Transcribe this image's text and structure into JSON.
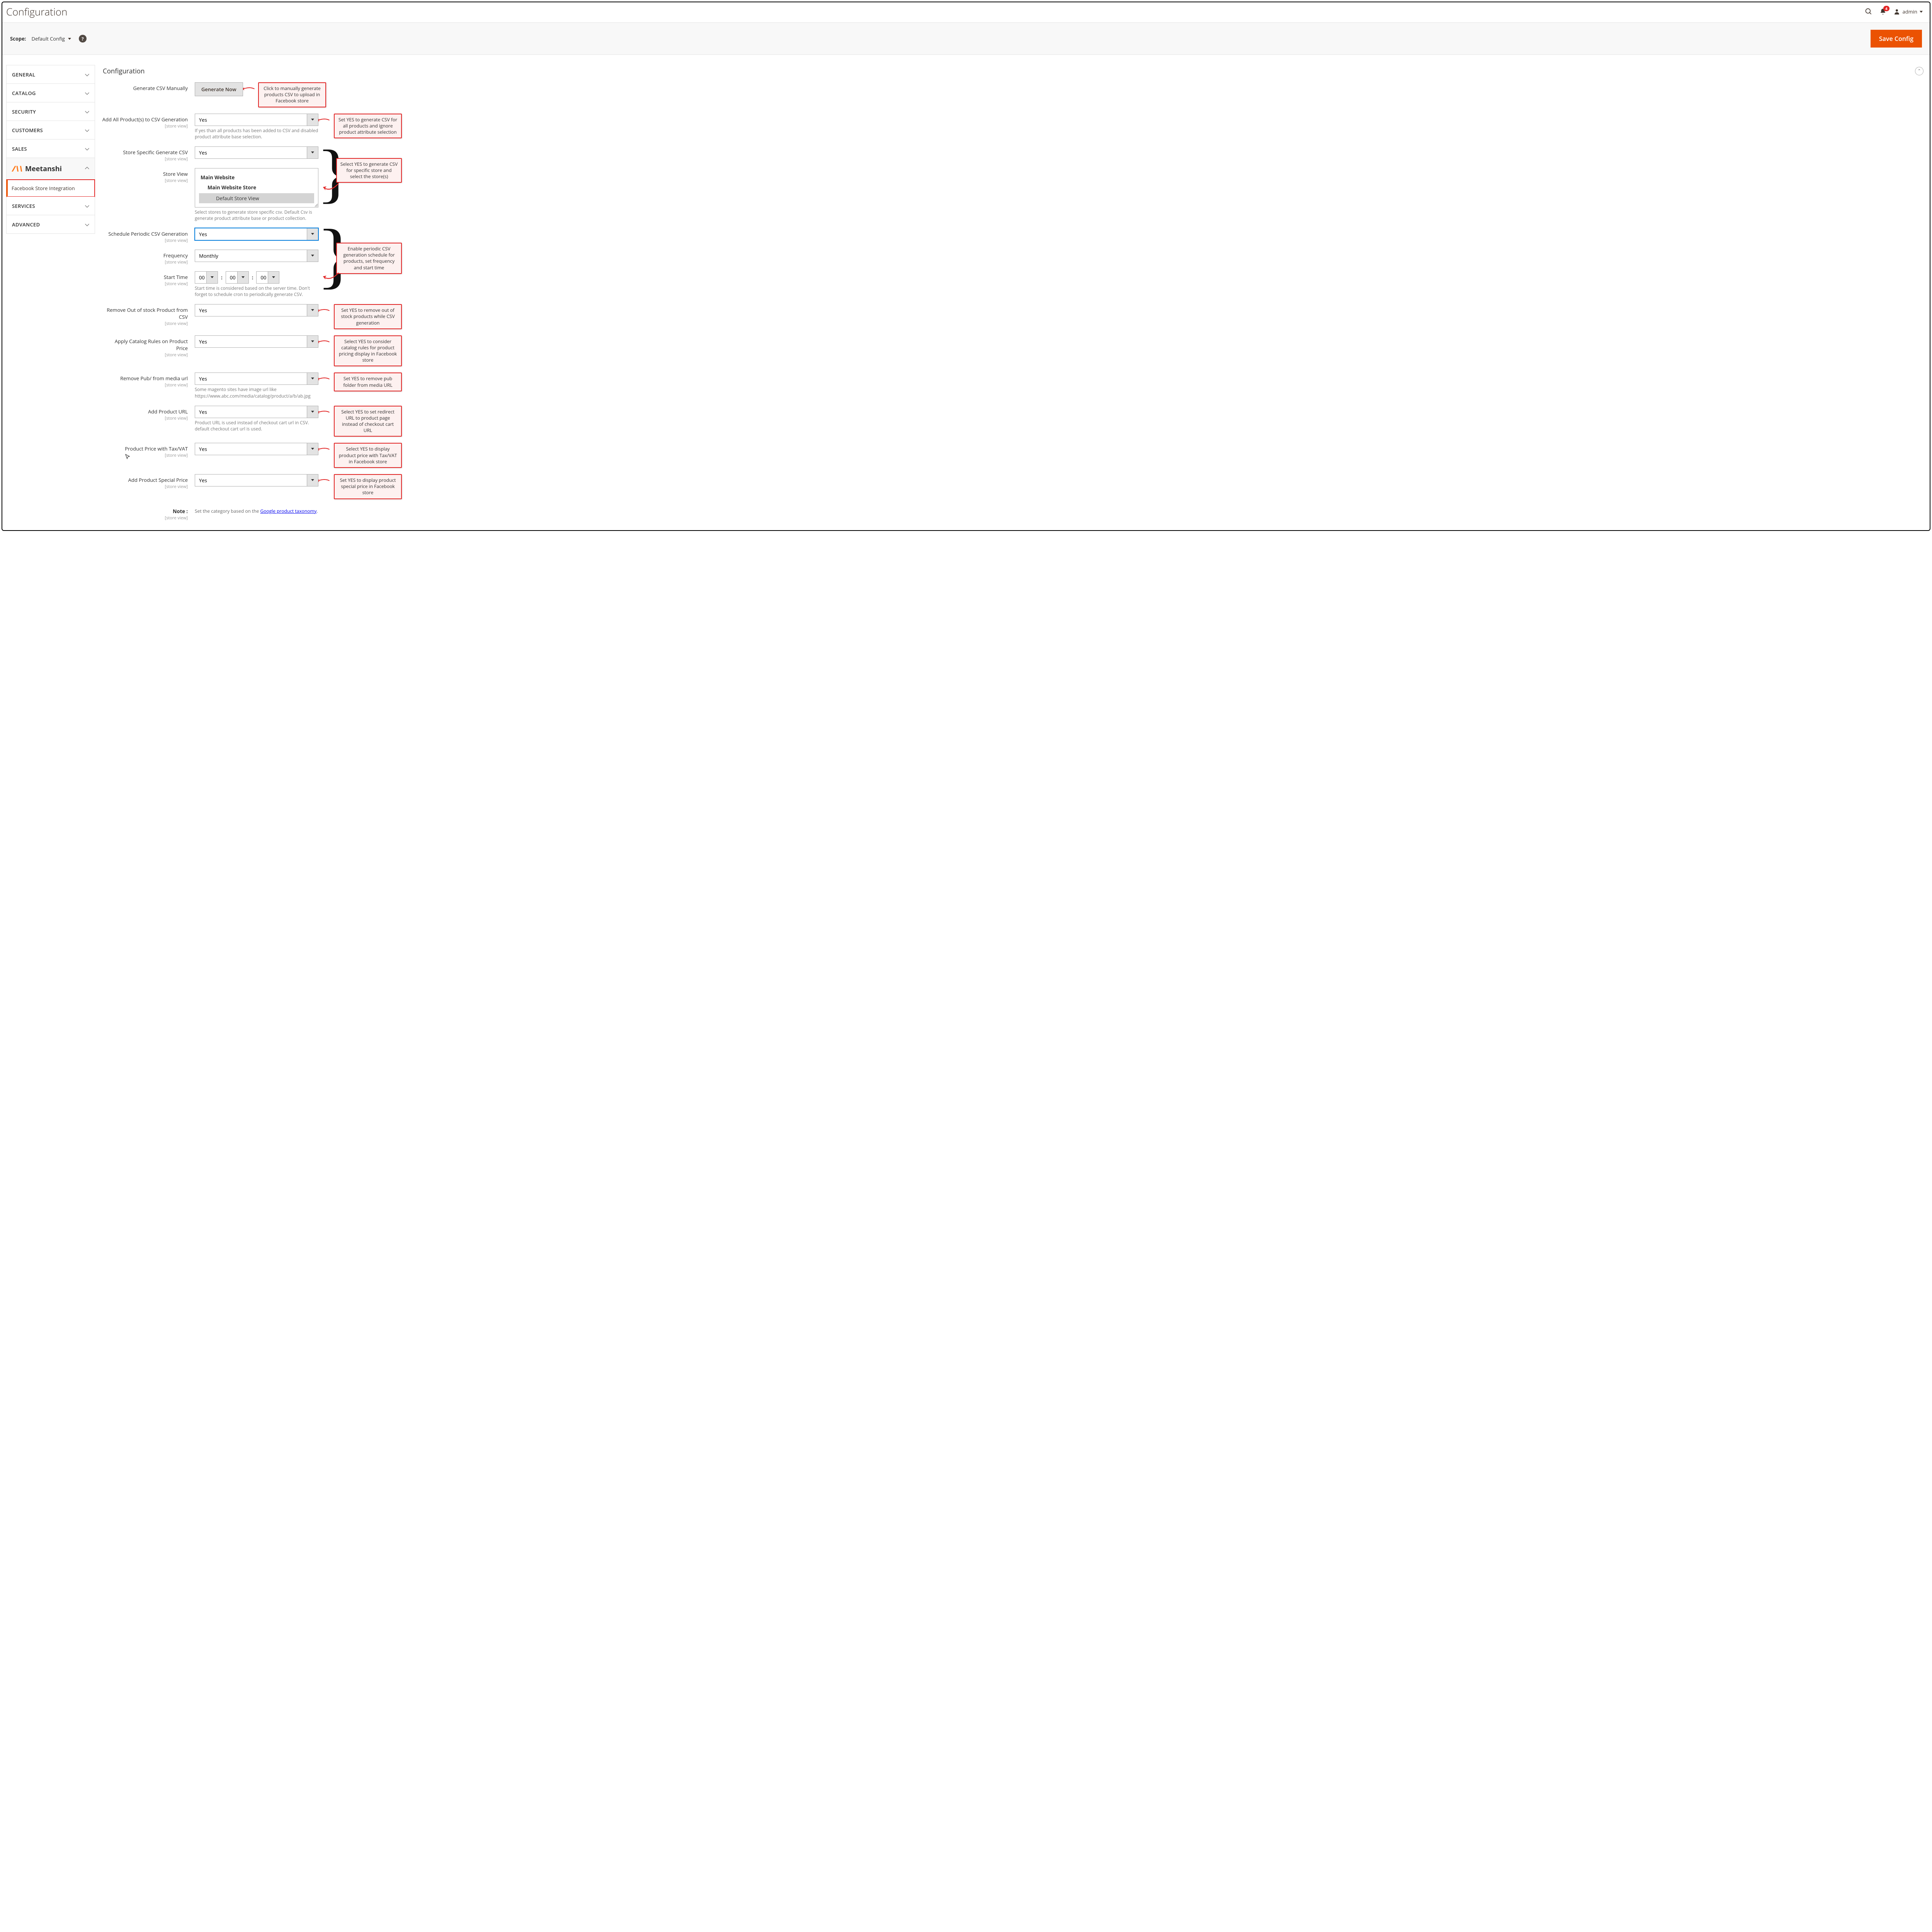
{
  "header": {
    "title": "Configuration",
    "notifications": "4",
    "user": "admin"
  },
  "scopebar": {
    "label": "Scope:",
    "value": "Default Config",
    "save": "Save Config"
  },
  "sidebar": {
    "items": [
      "GENERAL",
      "CATALOG",
      "SECURITY",
      "CUSTOMERS",
      "SALES"
    ],
    "parent": "Meetanshi",
    "active": "Facebook Store Integration",
    "items2": [
      "SERVICES",
      "ADVANCED"
    ]
  },
  "section": {
    "title": "Configuration"
  },
  "fields": {
    "gencsv": {
      "label": "Generate CSV Manually",
      "btn": "Generate Now"
    },
    "addall": {
      "label": "Add All Product(s) to CSV Generation",
      "val": "Yes",
      "note": "If yes than all products has been added to CSV and disabled product attribute base selection."
    },
    "storespec": {
      "label": "Store Specific Generate CSV",
      "val": "Yes"
    },
    "storeview": {
      "label": "Store View",
      "l1": "Main Website",
      "l2": "Main Website Store",
      "l3": "Default Store View",
      "note": "Select stores to generate store specific csv. Default Csv is generate product attribute base or product collection."
    },
    "schedule": {
      "label": "Schedule Periodic CSV Generation",
      "val": "Yes"
    },
    "freq": {
      "label": "Frequency",
      "val": "Monthly"
    },
    "start": {
      "label": "Start Time",
      "h": "00",
      "m": "00",
      "s": "00",
      "note": "Start time is considered based on the server time. Don't forget to schedule cron to periodically generate CSV."
    },
    "remove_oos": {
      "label": "Remove Out of stock Product from CSV",
      "val": "Yes"
    },
    "catalog_rules": {
      "label": "Apply Catalog Rules on Product Price",
      "val": "Yes"
    },
    "remove_pub": {
      "label": "Remove Pub/ from media url",
      "val": "Yes",
      "note": "Some magento sites have image url like https://www.abc.com/media/catalog/product/a/b/ab.jpg"
    },
    "prod_url": {
      "label": "Add Product URL",
      "val": "Yes",
      "note": "Product URL is used instead of checkout cart url in CSV. default checkout cart url is used."
    },
    "tax": {
      "label": "Product Price with Tax/VAT",
      "val": "Yes"
    },
    "special": {
      "label": "Add Product Special Price",
      "val": "Yes"
    },
    "notefield": {
      "label": "Note :",
      "text": "Set the category based on the ",
      "link": "Google product taxonomy",
      "suffix": "."
    }
  },
  "scope_hint": "[store view]",
  "callouts": {
    "gencsv": "Click to manually generate products CSV to upload in Facebook store",
    "addall": "Set YES to generate CSV for all products and ignore product attribute selection",
    "storegrp": "Select YES to generate CSV for specific store and select the store(s)",
    "schedgrp": "Enable periodic CSV generation schedule for products, set frequency and start time",
    "remove_oos": "Set YES to remove out of stock products while CSV generation",
    "catalog_rules": "Select YES to consider catalog rules for product pricing display in Facebook store",
    "remove_pub": "Set YES to remove pub folder from media URL",
    "prod_url": "Select YES to set redirect URL to product page instead of checkout cart URL",
    "tax": "Select YES to display product price with Tax/VAT in Facebook store",
    "special": "Set YES to display product special price in Facebook store"
  }
}
